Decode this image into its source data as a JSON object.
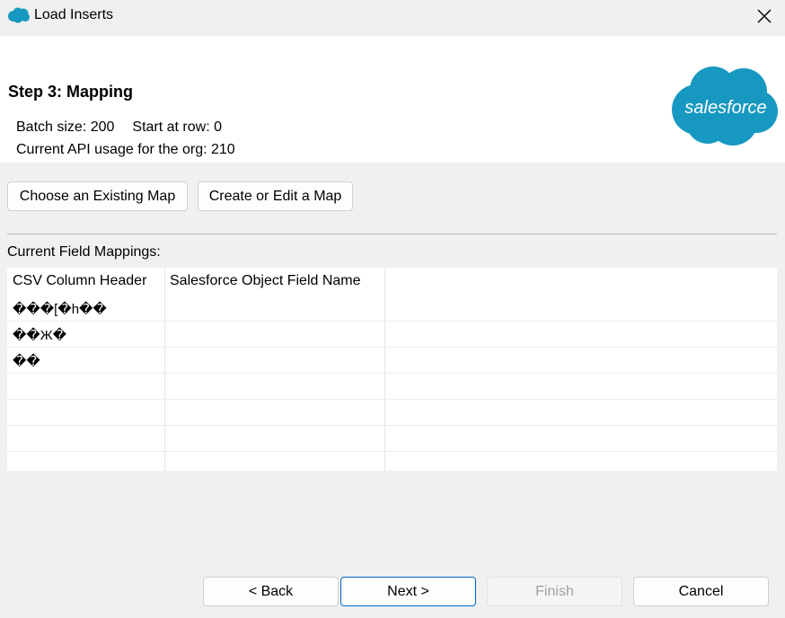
{
  "window": {
    "title": "Load Inserts",
    "icon": "salesforce-cloud-icon",
    "brand_color": "#1798c1"
  },
  "header": {
    "step_title": "Step 3: Mapping",
    "batch_size": "Batch size: 200",
    "start_row": "Start at row: 0",
    "api_usage": "Current API usage for the org: 210",
    "logo_text": "salesforce"
  },
  "map_buttons": {
    "choose_existing": "Choose an Existing Map",
    "create_edit": "Create or Edit a Map"
  },
  "mappings": {
    "label": "Current Field Mappings:",
    "columns": [
      "CSV Column Header",
      "Salesforce Object Field Name"
    ],
    "rows": [
      [
        "���[�h��",
        ""
      ],
      [
        "��Ж�",
        ""
      ],
      [
        "��",
        ""
      ]
    ]
  },
  "nav": {
    "back": "< Back",
    "next": "Next >",
    "finish": "Finish",
    "cancel": "Cancel"
  }
}
